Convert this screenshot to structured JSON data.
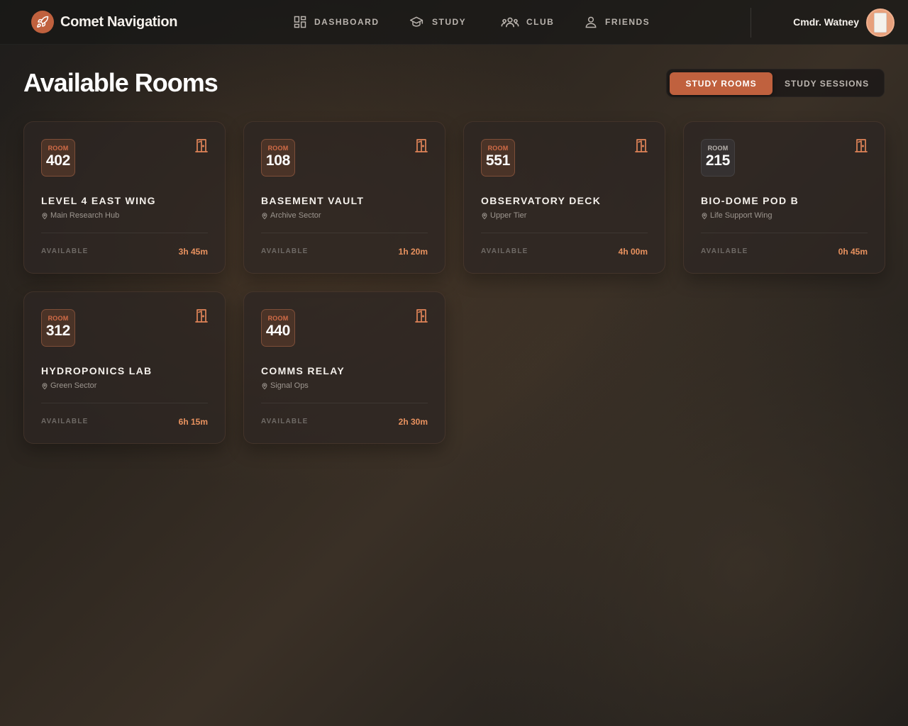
{
  "app": {
    "name": "Comet Navigation",
    "user_name": "Cmdr. Watney"
  },
  "nav": [
    {
      "label": "DASHBOARD",
      "icon": "dashboard-grid-icon"
    },
    {
      "label": "STUDY",
      "icon": "graduation-cap-icon"
    },
    {
      "label": "CLUB",
      "icon": "users-group-icon"
    },
    {
      "label": "FRIENDS",
      "icon": "user-icon"
    }
  ],
  "page": {
    "title": "Available Rooms",
    "toggle": {
      "active_label": "STUDY ROOMS",
      "inactive_label": "STUDY SESSIONS"
    }
  },
  "rooms": [
    {
      "badge_label": "ROOM",
      "number": "402",
      "name": "LEVEL 4 EAST WING",
      "location": "Main Research Hub",
      "status": "AVAILABLE",
      "duration": "3h 45m"
    },
    {
      "badge_label": "ROOM",
      "number": "108",
      "name": "BASEMENT VAULT",
      "location": "Archive Sector",
      "status": "AVAILABLE",
      "duration": "1h 20m"
    },
    {
      "badge_label": "ROOM",
      "number": "551",
      "name": "OBSERVATORY DECK",
      "location": "Upper Tier",
      "status": "AVAILABLE",
      "duration": "4h 00m"
    },
    {
      "badge_label": "ROOM",
      "number": "215",
      "name": "BIO-DOME POD B",
      "location": "Life Support Wing",
      "status": "AVAILABLE",
      "duration": "0h 45m"
    },
    {
      "badge_label": "ROOM",
      "number": "312",
      "name": "HYDROPONICS LAB",
      "location": "Green Sector",
      "status": "AVAILABLE",
      "duration": "6h 15m"
    },
    {
      "badge_label": "ROOM",
      "number": "440",
      "name": "COMMS RELAY",
      "location": "Signal Ops",
      "status": "AVAILABLE",
      "duration": "2h 30m"
    }
  ],
  "colors": {
    "accent": "#c0613e",
    "duration": "#e9925f",
    "background": "#2e2720"
  }
}
